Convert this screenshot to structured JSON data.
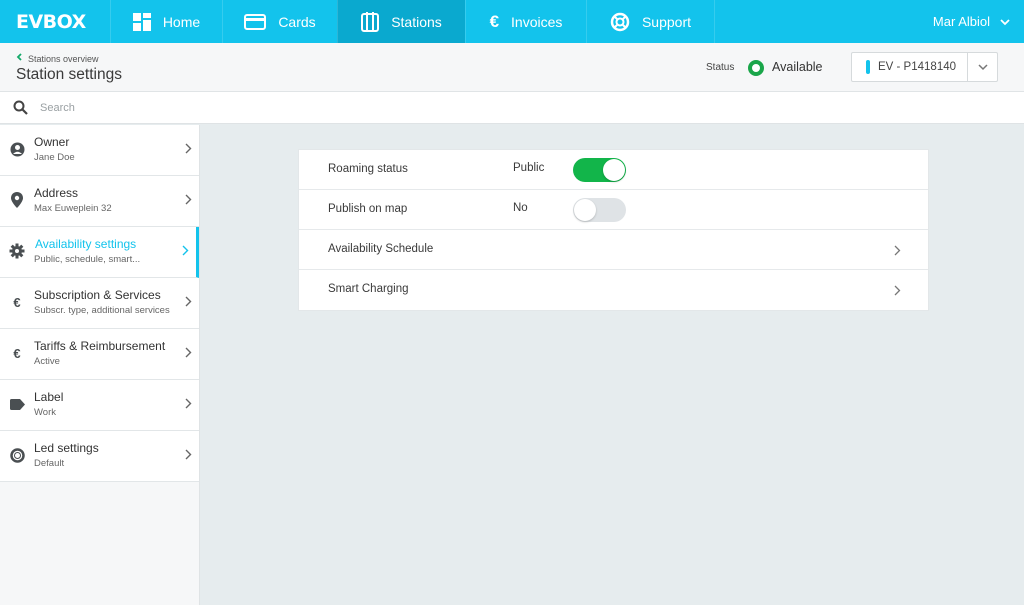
{
  "colors": {
    "accent": "#13c3ec",
    "nav_active": "#0aa9cf",
    "status_ok": "#1aa64a",
    "toggle_on": "#12b54a"
  },
  "nav": {
    "logo": "EVBOX",
    "items": [
      {
        "label": "Home",
        "icon": "home-icon"
      },
      {
        "label": "Cards",
        "icon": "card-icon"
      },
      {
        "label": "Stations",
        "icon": "station-icon"
      },
      {
        "label": "Invoices",
        "icon": "euro-icon"
      },
      {
        "label": "Support",
        "icon": "lifebuoy-icon"
      }
    ],
    "user": "Mar Albiol"
  },
  "header": {
    "breadcrumb": "Stations overview",
    "title": "Station settings",
    "status_label": "Status",
    "status_value": "Available",
    "station_id": "EV - P1418140"
  },
  "search": {
    "placeholder": "Search"
  },
  "sidebar": {
    "items": [
      {
        "title": "Owner",
        "sub": "Jane Doe",
        "icon": "user-icon"
      },
      {
        "title": "Address",
        "sub": "Max Euweplein 32",
        "icon": "pin-icon"
      },
      {
        "title": "Availability settings",
        "sub": "Public, schedule, smart...",
        "icon": "gear-icon"
      },
      {
        "title": "Subscription & Services",
        "sub": "Subscr. type, additional services",
        "icon": "euro-icon"
      },
      {
        "title": "Tariffs & Reimbursement",
        "sub": "Active",
        "icon": "euro-icon"
      },
      {
        "title": "Label",
        "sub": "Work",
        "icon": "tag-icon"
      },
      {
        "title": "Led settings",
        "sub": "Default",
        "icon": "led-icon"
      }
    ]
  },
  "settings": {
    "roaming": {
      "label": "Roaming status",
      "value": "Public",
      "enabled": true
    },
    "publish": {
      "label": "Publish on map",
      "value": "No",
      "enabled": false
    },
    "schedule": {
      "label": "Availability Schedule"
    },
    "smart": {
      "label": "Smart Charging"
    }
  }
}
